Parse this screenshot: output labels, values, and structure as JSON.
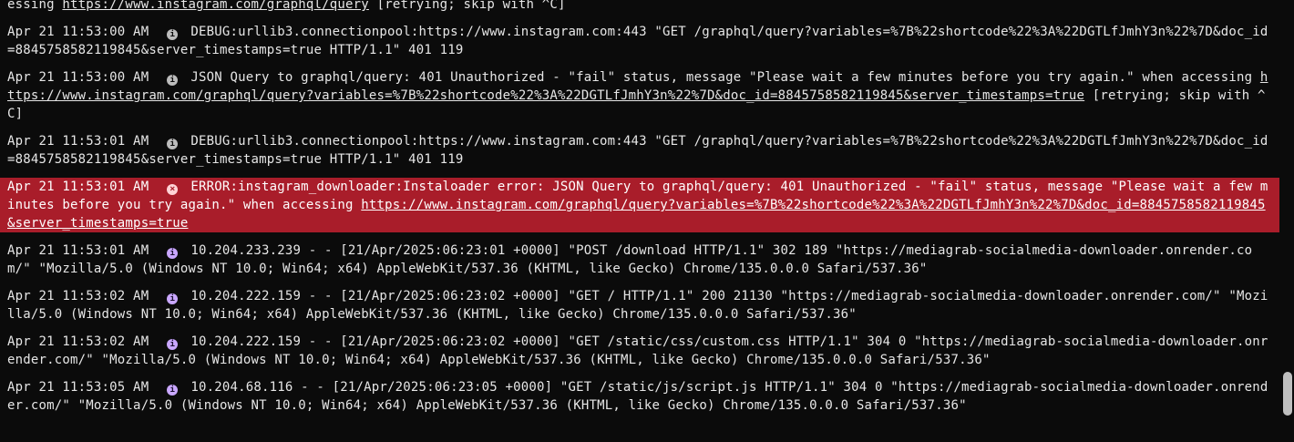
{
  "log": {
    "entries": [
      {
        "kind": "plain",
        "ts": "",
        "icon": "",
        "parts": [
          {
            "t": "essing "
          },
          {
            "t": "https://www.instagram.com/graphql/query",
            "link": true
          },
          {
            "t": " [retrying; skip with ^C]"
          }
        ]
      },
      {
        "kind": "debug",
        "ts": "Apr 21 11:53:00 AM",
        "icon": "info-icon",
        "parts": [
          {
            "t": "DEBUG:urllib3.connectionpool:https://www.instagram.com:443 \"GET /graphql/query?variables=%7B%22shortcode%22%3A%22DGTLfJmhY3n%22%7D&doc_id=8845758582119845&server_timestamps=true HTTP/1.1\" 401 119"
          }
        ]
      },
      {
        "kind": "info",
        "ts": "Apr 21 11:53:00 AM",
        "icon": "info-icon",
        "parts": [
          {
            "t": "JSON Query to graphql/query: 401 Unauthorized - \"fail\" status, message \"Please wait a few minutes before you try again.\" when accessing "
          },
          {
            "t": "https://www.instagram.com/graphql/query?variables=%7B%22shortcode%22%3A%22DGTLfJmhY3n%22%7D&doc_id=8845758582119845&server_timestamps=true",
            "link": true
          },
          {
            "t": " [retrying; skip with ^C]"
          }
        ]
      },
      {
        "kind": "debug",
        "ts": "Apr 21 11:53:01 AM",
        "icon": "info-icon",
        "parts": [
          {
            "t": "DEBUG:urllib3.connectionpool:https://www.instagram.com:443 \"GET /graphql/query?variables=%7B%22shortcode%22%3A%22DGTLfJmhY3n%22%7D&doc_id=8845758582119845&server_timestamps=true HTTP/1.1\" 401 119"
          }
        ]
      },
      {
        "kind": "error",
        "ts": "Apr 21 11:53:01 AM",
        "icon": "error-icon",
        "parts": [
          {
            "t": "ERROR:instagram_downloader:Instaloader error: JSON Query to graphql/query: 401 Unauthorized - \"fail\" status, message \"Please wait a few minutes before you try again.\" when accessing "
          },
          {
            "t": "https://www.instagram.com/graphql/query?variables=%7B%22shortcode%22%3A%22DGTLfJmhY3n%22%7D&doc_id=8845758582119845&server_timestamps=true",
            "link": true
          }
        ]
      },
      {
        "kind": "access",
        "ts": "Apr 21 11:53:01 AM",
        "icon": "info-icon",
        "parts": [
          {
            "t": "10.204.233.239 - - [21/Apr/2025:06:23:01 +0000] \"POST /download HTTP/1.1\" 302 189 \"https://mediagrab-socialmedia-downloader.onrender.com/\" \"Mozilla/5.0 (Windows NT 10.0; Win64; x64) AppleWebKit/537.36 (KHTML, like Gecko) Chrome/135.0.0.0 Safari/537.36\""
          }
        ]
      },
      {
        "kind": "access",
        "ts": "Apr 21 11:53:02 AM",
        "icon": "info-icon",
        "parts": [
          {
            "t": "10.204.222.159 - - [21/Apr/2025:06:23:02 +0000] \"GET / HTTP/1.1\" 200 21130 \"https://mediagrab-socialmedia-downloader.onrender.com/\" \"Mozilla/5.0 (Windows NT 10.0; Win64; x64) AppleWebKit/537.36 (KHTML, like Gecko) Chrome/135.0.0.0 Safari/537.36\""
          }
        ]
      },
      {
        "kind": "access",
        "ts": "Apr 21 11:53:02 AM",
        "icon": "info-icon",
        "parts": [
          {
            "t": "10.204.222.159 - - [21/Apr/2025:06:23:02 +0000] \"GET /static/css/custom.css HTTP/1.1\" 304 0 \"https://mediagrab-socialmedia-downloader.onrender.com/\" \"Mozilla/5.0 (Windows NT 10.0; Win64; x64) AppleWebKit/537.36 (KHTML, like Gecko) Chrome/135.0.0.0 Safari/537.36\""
          }
        ]
      },
      {
        "kind": "access",
        "ts": "Apr 21 11:53:05 AM",
        "icon": "info-icon",
        "parts": [
          {
            "t": "10.204.68.116 - - [21/Apr/2025:06:23:05 +0000] \"GET /static/js/script.js HTTP/1.1\" 304 0 \"https://mediagrab-socialmedia-downloader.onrender.com/\" \"Mozilla/5.0 (Windows NT 10.0; Win64; x64) AppleWebKit/537.36 (KHTML, like Gecko) Chrome/135.0.0.0 Safari/537.36\""
          }
        ]
      }
    ]
  },
  "colors": {
    "background": "#0b0b0b",
    "text": "#e6e6e6",
    "error_row": "#a91d2a",
    "debug_icon": "#bcbcbc",
    "info_icon": "#c9a7ff"
  },
  "icons": {
    "info": "ⓘ",
    "error": "⊗"
  }
}
